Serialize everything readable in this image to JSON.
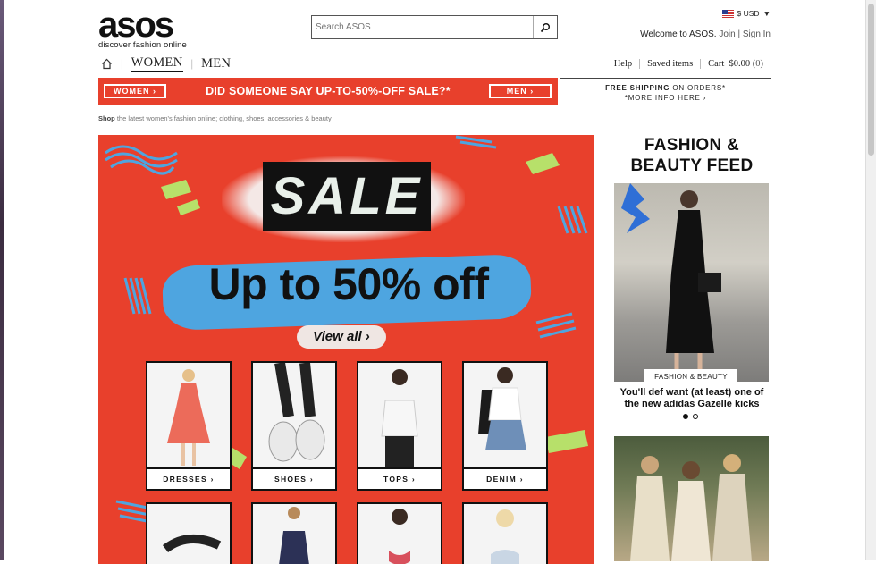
{
  "header": {
    "logo_text": "asos",
    "tagline": "discover fashion online",
    "search_placeholder": "Search ASOS",
    "currency": "$ USD",
    "welcome": "Welcome to ASOS.",
    "join": "Join",
    "sign_in": "Sign In"
  },
  "nav": {
    "tabs": [
      {
        "label": "WOMEN"
      },
      {
        "label": "MEN"
      }
    ],
    "help": "Help",
    "saved": "Saved items",
    "cart": "Cart",
    "cart_amount": "$0.00",
    "cart_count": "(0)"
  },
  "promo": {
    "women_btn": "WOMEN ›",
    "text": "DID SOMEONE SAY UP-TO-50%-OFF SALE?*",
    "men_btn": "MEN ›",
    "shipping_bold": "FREE SHIPPING",
    "shipping_rest": " ON ORDERS*",
    "shipping_more": "*MORE INFO HERE ›"
  },
  "shop_line": {
    "bold": "Shop",
    "rest": " the latest women's fashion online; clothing, shoes, accessories & beauty"
  },
  "hero": {
    "sale": "SALE",
    "headline": "Up to 50% off",
    "view_all": "View all ›",
    "categories": [
      {
        "label": "DRESSES ›"
      },
      {
        "label": "SHOES ›"
      },
      {
        "label": "TOPS ›"
      },
      {
        "label": "DENIM ›"
      }
    ]
  },
  "feed": {
    "title_line1": "FASHION &",
    "title_line2": "BEAUTY FEED",
    "tag": "FASHION & BEAUTY",
    "caption": "You'll def want (at least) one of the new adidas Gazelle kicks"
  },
  "colors": {
    "brand_red": "#e8402c",
    "accent_blue": "#4ea5e0",
    "accent_lime": "#b7e06a"
  }
}
